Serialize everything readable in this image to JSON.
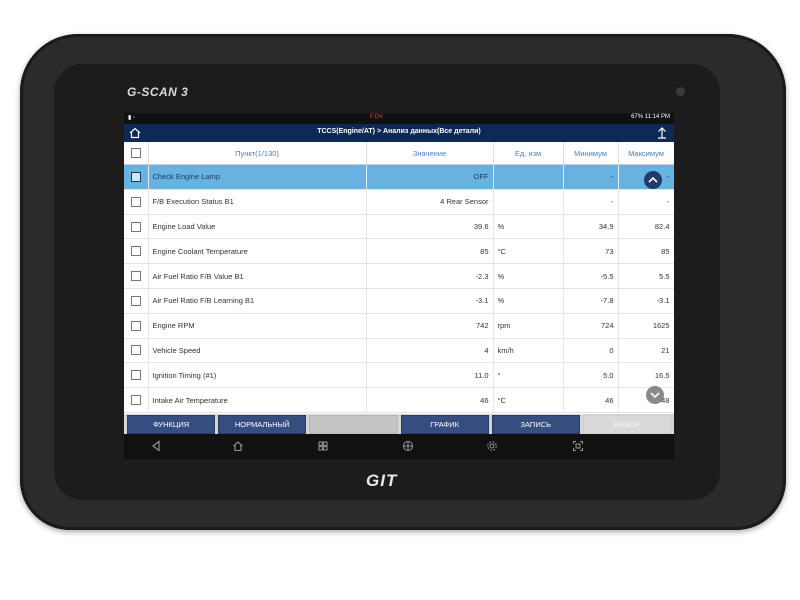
{
  "device": {
    "brand": "G-SCAN 3",
    "maker": "GIT"
  },
  "statusbar": {
    "center": "F.DV",
    "right": "67% 11:14 PM"
  },
  "header": {
    "title": "TCCS(Engine/AT) > Анализ данных(Все детали)"
  },
  "table": {
    "columns": [
      "Пункт(1/130)",
      "Значение",
      "Ед. изм",
      "Минимум",
      "Максимум"
    ],
    "rows": [
      {
        "name": "Check Engine Lamp",
        "value": "OFF",
        "unit": "",
        "min": "-",
        "max": "-",
        "selected": true
      },
      {
        "name": "F/B Execution Status B1",
        "value": "4 Rear Sensor",
        "unit": "",
        "min": "-",
        "max": "-"
      },
      {
        "name": "Engine Load Value",
        "value": "39.6",
        "unit": "%",
        "min": "34.9",
        "max": "82.4"
      },
      {
        "name": "Engine Coolant Temperature",
        "value": "85",
        "unit": "°C",
        "min": "73",
        "max": "85"
      },
      {
        "name": "Air Fuel Ratio F/B Value B1",
        "value": "-2.3",
        "unit": "%",
        "min": "-5.5",
        "max": "5.5"
      },
      {
        "name": "Air Fuel Ratio F/B Learning B1",
        "value": "-3.1",
        "unit": "%",
        "min": "-7.8",
        "max": "-3.1"
      },
      {
        "name": "Engine RPM",
        "value": "742",
        "unit": "rpm",
        "min": "724",
        "max": "1625"
      },
      {
        "name": "Vehicle Speed",
        "value": "4",
        "unit": "km/h",
        "min": "0",
        "max": "21"
      },
      {
        "name": "Ignition Timing (#1)",
        "value": "11.0",
        "unit": "°",
        "min": "5.0",
        "max": "16.5"
      },
      {
        "name": "Intake Air Temperature",
        "value": "46",
        "unit": "°C",
        "min": "46",
        "max": "48"
      }
    ]
  },
  "buttons": {
    "function": "ФУНКЦИЯ",
    "normal": "НОРМАЛЬНЫЙ",
    "graph": "ГРАФИК",
    "record": "ЗАПИСЬ",
    "select": "ВЫБОР"
  },
  "icons": {
    "home": "home-icon",
    "export": "upload-icon",
    "back": "back-icon",
    "apps": "apps-icon",
    "browser": "globe-icon",
    "settings": "gear-icon",
    "screenshot": "screenshot-icon"
  }
}
